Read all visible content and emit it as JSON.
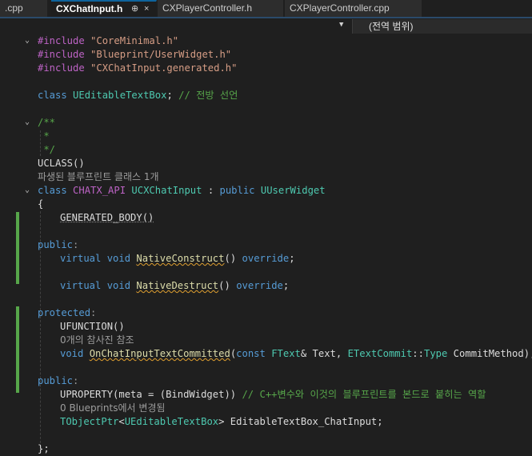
{
  "tabs": [
    {
      "label": ".cpp"
    },
    {
      "label": "CXChatInput.h"
    },
    {
      "label": "CXPlayerController.h"
    },
    {
      "label": "CXPlayerController.cpp"
    }
  ],
  "tab_pin_glyph": "⊕",
  "tab_close_glyph": "×",
  "scope_label": "(전역 범위)",
  "code": {
    "inc1_kw": "#include",
    "inc1_file": "\"CoreMinimal.h\"",
    "inc2_kw": "#include",
    "inc2_file": "\"Blueprint/UserWidget.h\"",
    "inc3_kw": "#include",
    "inc3_file": "\"CXChatInput.generated.h\"",
    "fwd_kw": "class",
    "fwd_type": "UEditableTextBox",
    "fwd_rest": ";",
    "fwd_comment": "// 전방 선언",
    "doc1": "/**",
    "doc2": " *",
    "doc3": " */",
    "uclass": "UCLASS()",
    "hint_blueprint": "파생된 블루프린트 클래스 1개",
    "class_kw": "class",
    "class_api": "CHATX_API",
    "class_name": "UCXChatInput",
    "class_colon": " : ",
    "class_public": "public",
    "class_base": "UUserWidget",
    "brace_open": "{",
    "gen_body": "GENERATED_BODY()",
    "public1": "public",
    "colon": ":",
    "virtual1": "virtual",
    "void1": "void",
    "native_construct": "NativeConstruct",
    "parens": "()",
    "override1": "override",
    "semi": ";",
    "virtual2": "virtual",
    "void2": "void",
    "native_destruct": "NativeDestruct",
    "override2": "override",
    "protected": "protected",
    "ufunction": "UFUNCTION()",
    "hint_refs": "0개의 참사진 참조",
    "void3": "void",
    "on_commit": "OnChatInputTextCommitted",
    "paren_open": "(",
    "const_kw": "const",
    "ftext": "FText",
    "amp_text": "& Text, ",
    "etextcommit": "ETextCommit",
    "scope_op": "::",
    "type_t": "Type",
    "commit_method": " CommitMethod",
    "paren_close_semi": ");",
    "public2": "public",
    "uproperty": "UPROPERTY(meta = (BindWidget))",
    "uprop_comment": "// C++변수와 이것의 블루프린트를 본드로 붙히는 역할",
    "hint_blueprints": "0 Blueprints에서 변경됨",
    "tobjectptr": "TObjectPtr",
    "lt": "<",
    "ueditable": "UEditableTextBox",
    "gt": ">",
    "member": " EditableTextBox_ChatInput;",
    "brace_close": "};"
  }
}
